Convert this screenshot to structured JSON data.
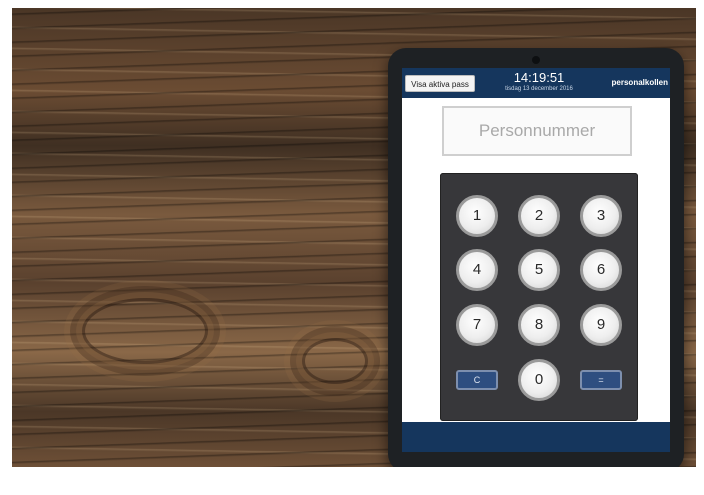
{
  "header": {
    "show_active_shifts_button": "Visa aktiva pass",
    "time": "14:19:51",
    "date": "tisdag 13 december 2016",
    "brand": "personalkollen"
  },
  "personnummer_field": {
    "placeholder": "Personnummer"
  },
  "keypad": {
    "keys": [
      "1",
      "2",
      "3",
      "4",
      "5",
      "6",
      "7",
      "8",
      "9"
    ],
    "clear_key": "C",
    "zero_key": "0",
    "submit_key": "="
  },
  "colors": {
    "header_bar": "#15365d",
    "keypad_bg": "#37373a",
    "action_key": "#2e4e80"
  }
}
